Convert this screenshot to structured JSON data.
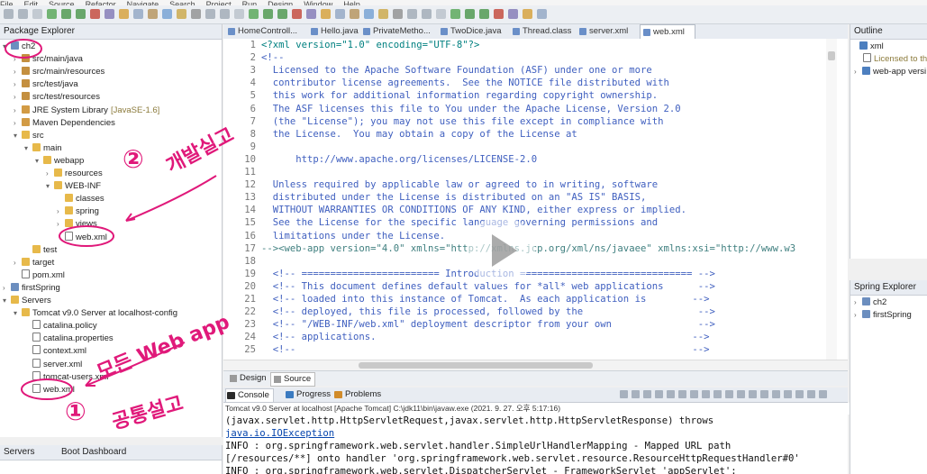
{
  "menu": [
    "File",
    "Edit",
    "Source",
    "Refactor",
    "Navigate",
    "Search",
    "Project",
    "Run",
    "Design",
    "Window",
    "Help"
  ],
  "package_explorer": {
    "title": "Package Explorer",
    "items": [
      {
        "label": "ch2",
        "depth": 0,
        "arrow": "▾",
        "icon": "prj"
      },
      {
        "label": "src/main/java",
        "depth": 1,
        "arrow": "›",
        "icon": "pkg"
      },
      {
        "label": "src/main/resources",
        "depth": 1,
        "arrow": "›",
        "icon": "pkg"
      },
      {
        "label": "src/test/java",
        "depth": 1,
        "arrow": "›",
        "icon": "pkg"
      },
      {
        "label": "src/test/resources",
        "depth": 1,
        "arrow": "›",
        "icon": "pkg"
      },
      {
        "label": "JRE System Library",
        "suffix": "[JavaSE-1.6]",
        "depth": 1,
        "arrow": "›",
        "icon": "lib"
      },
      {
        "label": "Maven Dependencies",
        "depth": 1,
        "arrow": "›",
        "icon": "lib"
      },
      {
        "label": "src",
        "depth": 1,
        "arrow": "▾",
        "icon": "fold"
      },
      {
        "label": "main",
        "depth": 2,
        "arrow": "▾",
        "icon": "fold"
      },
      {
        "label": "webapp",
        "depth": 3,
        "arrow": "▾",
        "icon": "fold"
      },
      {
        "label": "resources",
        "depth": 4,
        "arrow": "›",
        "icon": "fold"
      },
      {
        "label": "WEB-INF",
        "depth": 4,
        "arrow": "▾",
        "icon": "fold"
      },
      {
        "label": "classes",
        "depth": 5,
        "arrow": "",
        "icon": "fold"
      },
      {
        "label": "spring",
        "depth": 5,
        "arrow": "›",
        "icon": "fold"
      },
      {
        "label": "views",
        "depth": 5,
        "arrow": "›",
        "icon": "fold"
      },
      {
        "label": "web.xml",
        "depth": 5,
        "arrow": "",
        "icon": "xmlic"
      },
      {
        "label": "test",
        "depth": 2,
        "arrow": "",
        "icon": "fold"
      },
      {
        "label": "target",
        "depth": 1,
        "arrow": "›",
        "icon": "fold"
      },
      {
        "label": "pom.xml",
        "depth": 1,
        "arrow": "",
        "icon": "xmlic"
      },
      {
        "label": "firstSpring",
        "depth": 0,
        "arrow": "›",
        "icon": "prj"
      },
      {
        "label": "Servers",
        "depth": 0,
        "arrow": "▾",
        "icon": "fold"
      },
      {
        "label": "Tomcat v9.0 Server at localhost-config",
        "depth": 1,
        "arrow": "▾",
        "icon": "fold"
      },
      {
        "label": "catalina.policy",
        "depth": 2,
        "arrow": "",
        "icon": "xmlic"
      },
      {
        "label": "catalina.properties",
        "depth": 2,
        "arrow": "",
        "icon": "xmlic"
      },
      {
        "label": "context.xml",
        "depth": 2,
        "arrow": "",
        "icon": "xmlic"
      },
      {
        "label": "server.xml",
        "depth": 2,
        "arrow": "",
        "icon": "xmlic"
      },
      {
        "label": "tomcat-users.xml",
        "depth": 2,
        "arrow": "",
        "icon": "xmlic"
      },
      {
        "label": "web.xml",
        "depth": 2,
        "arrow": "",
        "icon": "xmlic"
      }
    ]
  },
  "editor_tabs": [
    "HomeControll...",
    "Hello.java",
    "PrivateMetho...",
    "TwoDice.java",
    "Thread.class",
    "server.xml",
    "web.xml"
  ],
  "editor_active_tab": "web.xml",
  "editor_lines": [
    {
      "n": "1",
      "t": "<?xml version=\"1.0\" encoding=\"UTF-8\"?>",
      "k": "pi"
    },
    {
      "n": "2",
      "t": "<!--",
      "k": "cm"
    },
    {
      "n": "3",
      "t": "  Licensed to the Apache Software Foundation (ASF) under one or more",
      "k": "cm"
    },
    {
      "n": "4",
      "t": "  contributor license agreements.  See the NOTICE file distributed with",
      "k": "cm"
    },
    {
      "n": "5",
      "t": "  this work for additional information regarding copyright ownership.",
      "k": "cm"
    },
    {
      "n": "6",
      "t": "  The ASF licenses this file to You under the Apache License, Version 2.0",
      "k": "cm"
    },
    {
      "n": "7",
      "t": "  (the \"License\"); you may not use this file except in compliance with",
      "k": "cm"
    },
    {
      "n": "8",
      "t": "  the License.  You may obtain a copy of the License at",
      "k": "cm"
    },
    {
      "n": "9",
      "t": "",
      "k": "cm"
    },
    {
      "n": "10",
      "t": "      http://www.apache.org/licenses/LICENSE-2.0",
      "k": "cm"
    },
    {
      "n": "11",
      "t": "",
      "k": "cm"
    },
    {
      "n": "12",
      "t": "  Unless required by applicable law or agreed to in writing, software",
      "k": "cm"
    },
    {
      "n": "13",
      "t": "  distributed under the License is distributed on an \"AS IS\" BASIS,",
      "k": "cm"
    },
    {
      "n": "14",
      "t": "  WITHOUT WARRANTIES OR CONDITIONS OF ANY KIND, either express or implied.",
      "k": "cm"
    },
    {
      "n": "15",
      "t": "  See the License for the specific language governing permissions and",
      "k": "cm"
    },
    {
      "n": "16",
      "t": "  limitations under the License.",
      "k": "cm"
    },
    {
      "n": "17",
      "t": "--><web-app version=\"4.0\" xmlns=\"http://xmlns.jcp.org/xml/ns/javaee\" xmlns:xsi=\"http://www.w3",
      "k": "tag"
    },
    {
      "n": "18",
      "t": "",
      "k": "cm"
    },
    {
      "n": "19",
      "t": "  <!-- ======================== Introduction ============================== -->",
      "k": "cm"
    },
    {
      "n": "20",
      "t": "  <!-- This document defines default values for *all* web applications      -->",
      "k": "cm"
    },
    {
      "n": "21",
      "t": "  <!-- loaded into this instance of Tomcat.  As each application is        -->",
      "k": "cm"
    },
    {
      "n": "22",
      "t": "  <!-- deployed, this file is processed, followed by the                    -->",
      "k": "cm"
    },
    {
      "n": "23",
      "t": "  <!-- \"/WEB-INF/web.xml\" deployment descriptor from your own               -->",
      "k": "cm"
    },
    {
      "n": "24",
      "t": "  <!-- applications.                                                       -->",
      "k": "cm"
    },
    {
      "n": "25",
      "t": "  <!--                                                                     -->",
      "k": "cm"
    }
  ],
  "design_tabs": [
    "Design",
    "Source"
  ],
  "console_tabs": [
    "Console",
    "Progress",
    "Problems"
  ],
  "console_subtitle": "Tomcat v9.0 Server at localhost [Apache Tomcat] C:\\jdk11\\bin\\javaw.exe  (2021. 9. 27. 오후 5:17:16)",
  "console_lines": [
    {
      "t": "(javax.servlet.http.HttpServletRequest,javax.servlet.http.HttpServletResponse) throws",
      "link": false
    },
    {
      "t": "java.io.IOException",
      "link": true
    },
    {
      "t": "INFO : org.springframework.web.servlet.handler.SimpleUrlHandlerMapping - Mapped URL path",
      "link": false
    },
    {
      "t": "[/resources/**] onto handler 'org.springframework.web.servlet.resource.ResourceHttpRequestHandler#0'",
      "link": false
    },
    {
      "t": "INFO : org.springframework.web.servlet.DispatcherServlet - FrameworkServlet 'appServlet':",
      "link": false
    }
  ],
  "outline": {
    "title": "Outline",
    "items": [
      "xml",
      "Licensed to th",
      "web-app versi"
    ]
  },
  "spring_explorer": {
    "title": "Spring Explorer",
    "items": [
      "ch2",
      "firstSpring"
    ]
  },
  "servers_view": {
    "tabs": [
      "Servers",
      "Boot Dashboard"
    ]
  },
  "annotations": {
    "n2": "②",
    "text2": "개발실고",
    "n1": "①",
    "text1a": "모든 Web app",
    "text1b": "공통설고"
  },
  "colors": {
    "annotation": "#e0197a"
  }
}
